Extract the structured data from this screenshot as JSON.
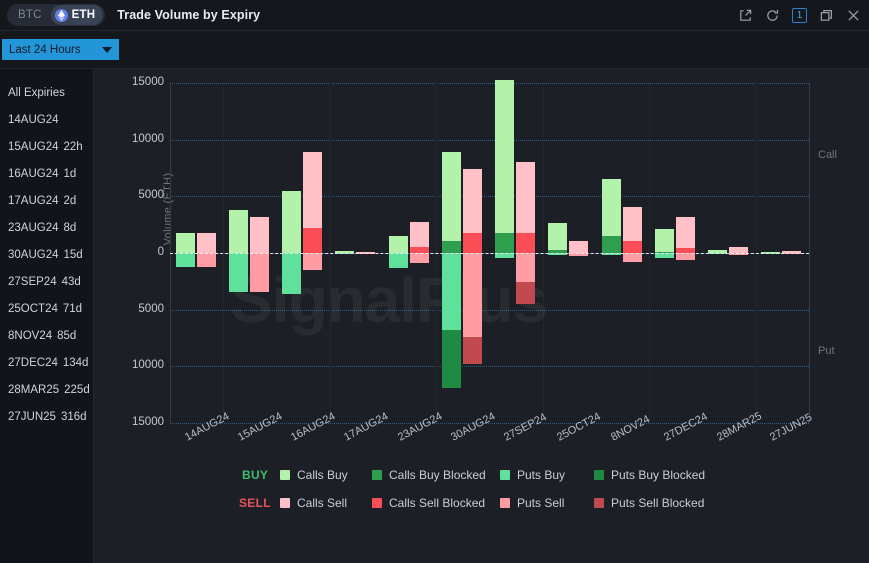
{
  "titlebar": {
    "coin_inactive": "BTC",
    "coin_active": "ETH",
    "title": "Trade Volume by Expiry",
    "icons": {
      "external_link": "external-link-icon",
      "refresh": "refresh-icon",
      "count_badge": "1",
      "restore": "restore-window-icon",
      "close": "close-icon"
    }
  },
  "toolbar": {
    "range_label": "Last 24 Hours"
  },
  "sidebar": {
    "items": [
      {
        "label": "All Expiries",
        "days": ""
      },
      {
        "label": "14AUG24",
        "days": ""
      },
      {
        "label": "15AUG24",
        "days": "22h"
      },
      {
        "label": "16AUG24",
        "days": "1d"
      },
      {
        "label": "17AUG24",
        "days": "2d"
      },
      {
        "label": "23AUG24",
        "days": "8d"
      },
      {
        "label": "30AUG24",
        "days": "15d"
      },
      {
        "label": "27SEP24",
        "days": "43d"
      },
      {
        "label": "25OCT24",
        "days": "71d"
      },
      {
        "label": "8NOV24",
        "days": "85d"
      },
      {
        "label": "27DEC24",
        "days": "134d"
      },
      {
        "label": "28MAR25",
        "days": "225d"
      },
      {
        "label": "27JUN25",
        "days": "316d"
      }
    ]
  },
  "chart_extra": {
    "watermark": "SignalPlus",
    "call_note": "Call",
    "put_note": "Put"
  },
  "legend": {
    "buy_label": "BUY",
    "sell_label": "SELL",
    "buy_color": "#3dbd6e",
    "sell_color": "#e8535c",
    "buy_items": [
      {
        "label": "Calls Buy",
        "color": "#b2f2ab"
      },
      {
        "label": "Calls Buy Blocked",
        "color": "#2f9e4f"
      },
      {
        "label": "Puts Buy",
        "color": "#5fe09b"
      },
      {
        "label": "Puts Buy Blocked",
        "color": "#1f8a43"
      }
    ],
    "sell_items": [
      {
        "label": "Calls Sell",
        "color": "#ffc0c7"
      },
      {
        "label": "Calls Sell Blocked",
        "color": "#fa4d55"
      },
      {
        "label": "Puts Sell",
        "color": "#ff9ca4"
      },
      {
        "label": "Puts Sell Blocked",
        "color": "#c04a4e"
      }
    ]
  },
  "chart_data": {
    "type": "bar",
    "title": "Trade Volume by Expiry",
    "xlabel": "",
    "ylabel": "Volume (ETH)",
    "ylim": [
      -15000,
      15000
    ],
    "ytick_values": [
      15000,
      10000,
      5000,
      0,
      -5000,
      -10000,
      -15000
    ],
    "ytick_labels": [
      "15000",
      "10000",
      "5000",
      "0",
      "5000",
      "10000",
      "15000"
    ],
    "grid": true,
    "legend_position": "bottom",
    "upper_region_label": "Call",
    "lower_region_label": "Put",
    "categories": [
      "14AUG24",
      "15AUG24",
      "16AUG24",
      "17AUG24",
      "23AUG24",
      "30AUG24",
      "27SEP24",
      "25OCT24",
      "8NOV24",
      "27DEC24",
      "28MAR25",
      "27JUN25"
    ],
    "series": [
      {
        "name": "Calls Buy",
        "group": "calls",
        "sign": "positive",
        "color": "#b2f2ab",
        "values": [
          1800,
          3800,
          5500,
          160,
          1500,
          7800,
          13500,
          2400,
          5000,
          2000,
          250,
          120
        ]
      },
      {
        "name": "Calls Buy Blocked",
        "group": "calls",
        "sign": "positive",
        "color": "#2f9e4f",
        "values": [
          0,
          0,
          0,
          0,
          0,
          1100,
          1800,
          250,
          1500,
          120,
          0,
          0
        ]
      },
      {
        "name": "Puts Buy",
        "group": "calls",
        "sign": "negative",
        "color": "#5fe09b",
        "values": [
          1250,
          3400,
          3600,
          50,
          1300,
          6800,
          450,
          200,
          200,
          400,
          100,
          80
        ]
      },
      {
        "name": "Puts Buy Blocked",
        "group": "calls",
        "sign": "negative",
        "color": "#1f8a43",
        "values": [
          0,
          0,
          0,
          0,
          0,
          5100,
          0,
          0,
          0,
          0,
          0,
          0
        ]
      },
      {
        "name": "Calls Sell",
        "group": "puts",
        "sign": "positive",
        "color": "#ffc0c7",
        "values": [
          1800,
          3200,
          6700,
          120,
          2200,
          5600,
          6200,
          1100,
          3000,
          2700,
          500,
          140
        ]
      },
      {
        "name": "Calls Sell Blocked",
        "group": "puts",
        "sign": "positive",
        "color": "#fa4d55",
        "values": [
          0,
          0,
          2200,
          0,
          500,
          1800,
          1800,
          0,
          1100,
          450,
          0,
          0
        ]
      },
      {
        "name": "Puts Sell",
        "group": "puts",
        "sign": "negative",
        "color": "#ff9ca4",
        "values": [
          1200,
          3400,
          1500,
          40,
          900,
          7400,
          2600,
          300,
          800,
          600,
          150,
          90
        ]
      },
      {
        "name": "Puts Sell Blocked",
        "group": "puts",
        "sign": "negative",
        "color": "#c04a4e",
        "values": [
          0,
          0,
          0,
          0,
          0,
          2400,
          1900,
          0,
          0,
          0,
          0,
          0
        ]
      }
    ]
  }
}
